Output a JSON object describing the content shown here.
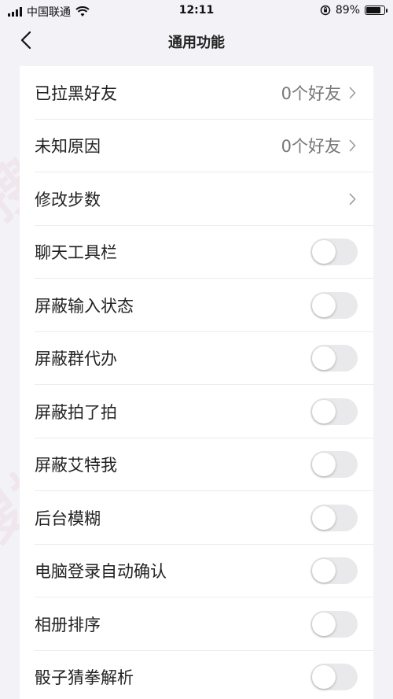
{
  "status_bar": {
    "carrier": "中国联通",
    "time": "12:11",
    "battery_percent": "89%",
    "battery_level": 0.89
  },
  "nav": {
    "title": "通用功能"
  },
  "settings": [
    {
      "label": "已拉黑好友",
      "type": "link",
      "value": "0个好友"
    },
    {
      "label": "未知原因",
      "type": "link",
      "value": "0个好友"
    },
    {
      "label": "修改步数",
      "type": "link",
      "value": ""
    },
    {
      "label": "聊天工具栏",
      "type": "toggle",
      "on": false
    },
    {
      "label": "屏蔽输入状态",
      "type": "toggle",
      "on": false
    },
    {
      "label": "屏蔽群代办",
      "type": "toggle",
      "on": false
    },
    {
      "label": "屏蔽拍了拍",
      "type": "toggle",
      "on": false
    },
    {
      "label": "屏蔽艾特我",
      "type": "toggle",
      "on": false
    },
    {
      "label": "后台模糊",
      "type": "toggle",
      "on": false
    },
    {
      "label": "电脑登录自动确认",
      "type": "toggle",
      "on": false
    },
    {
      "label": "相册排序",
      "type": "toggle",
      "on": false
    },
    {
      "label": "骰子猜拳解析",
      "type": "toggle",
      "on": false
    }
  ],
  "watermark": {
    "text": "搜搜码",
    "color": "#dc3c46"
  }
}
